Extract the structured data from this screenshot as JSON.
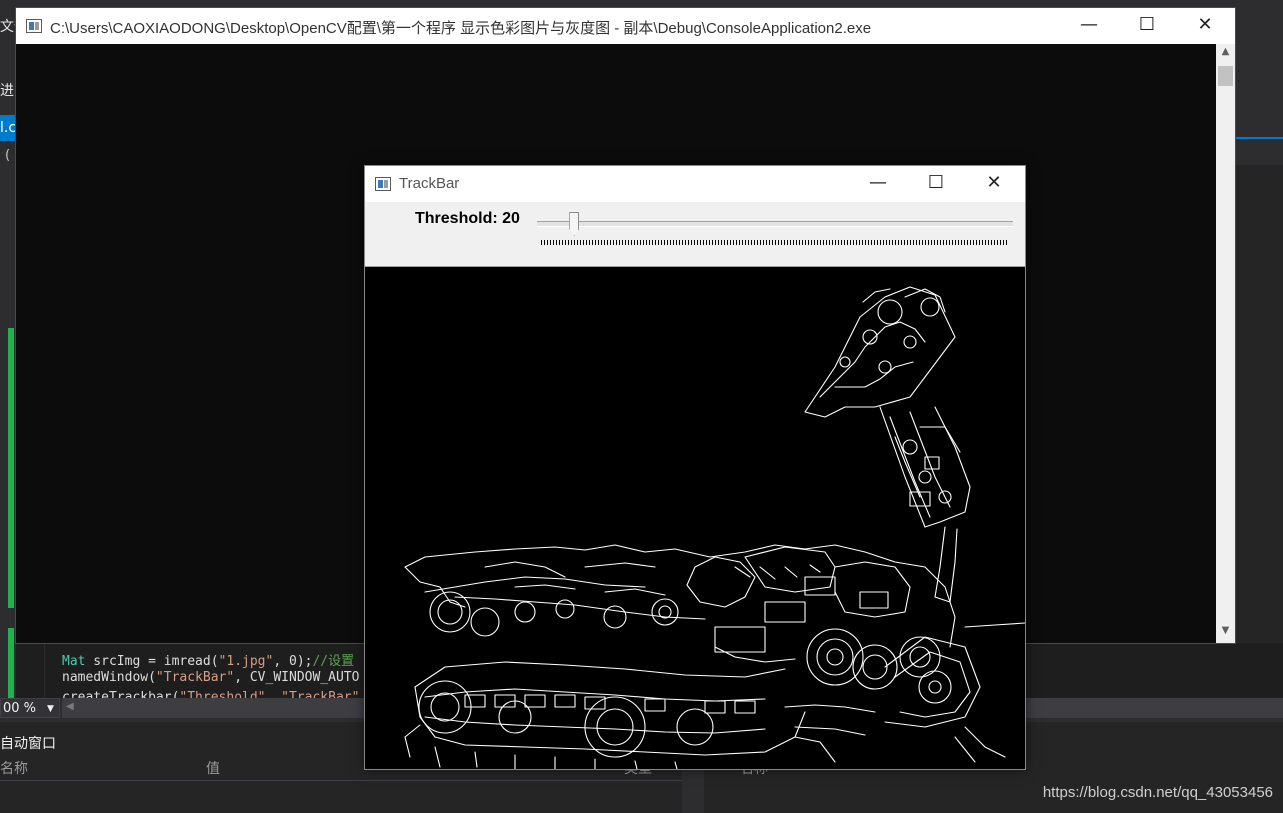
{
  "vs": {
    "menu_fragment": "文件",
    "toolbar_fragment": "进",
    "tab_fragment": "l.c",
    "gutter_fragment": "(",
    "code_lines": [
      {
        "type": "Mat",
        "rest": " srcImg = imread(",
        "str": "\"1.jpg\"",
        "tail": ", 0);",
        "comment": "//设置"
      },
      {
        "plain": "namedWindow(",
        "str": "\"TrackBar\"",
        "tail": ", CV_WINDOW_AUTO"
      },
      {
        "plain": "createTrackbar(",
        "str": "\"Threshold\", \"TrackBar\"",
        "tail": ""
      }
    ],
    "zoom_value": "00 %",
    "autos_title": "自动窗口",
    "col_name": "名称",
    "col_value": "值",
    "col_type": "类型",
    "right_col_name": "名称"
  },
  "console": {
    "title": "C:\\Users\\CAOXIAODONG\\Desktop\\OpenCV配置\\第一个程序 显示色彩图片与灰度图 - 副本\\Debug\\ConsoleApplication2.exe",
    "minimize_glyph": "—",
    "maximize_glyph": "☐",
    "close_glyph": "✕",
    "scroll_up_glyph": "▲",
    "scroll_down_glyph": "▼"
  },
  "trackbar": {
    "title": "TrackBar",
    "label": "Threshold: 20",
    "value": 20,
    "max": 255,
    "minimize_glyph": "—",
    "maximize_glyph": "☐",
    "close_glyph": "✕"
  },
  "watermark": "https://blog.csdn.net/qq_43053456",
  "colors": {
    "vs_background": "#2d2d30",
    "vs_accent": "#007acc",
    "console_background": "#0c0c0c",
    "edge_lines": "#ffffff",
    "image_background": "#000000"
  }
}
